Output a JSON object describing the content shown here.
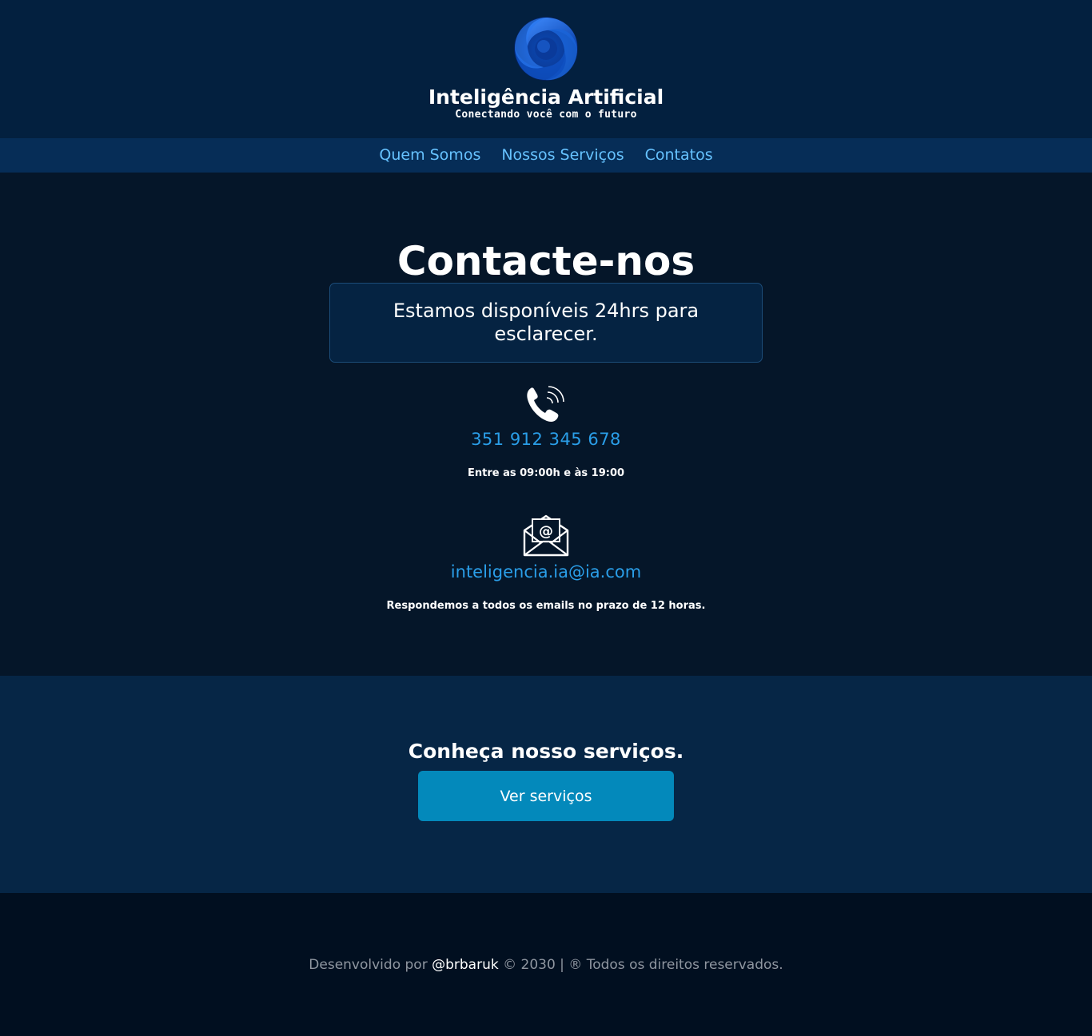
{
  "header": {
    "logo_icon": "swirl-logo-icon",
    "title": "Inteligência Artificial",
    "tagline": "Conectando você com o futuro"
  },
  "nav": {
    "items": [
      {
        "label": "Quem Somos"
      },
      {
        "label": "Nossos Serviços"
      },
      {
        "label": "Contatos"
      }
    ]
  },
  "contact": {
    "title": "Contacte-nos",
    "availability": "Estamos disponíveis 24hrs para esclarecer.",
    "phone_icon": "phone-icon",
    "phone": "351 912 345 678",
    "phone_hours": "Entre as 09:00h e às 19:00",
    "email_icon": "mail-icon",
    "email": "inteligencia.ia@ia.com",
    "email_note": "Respondemos a todos os emails no prazo de 12 horas."
  },
  "services": {
    "title": "Conheça nosso serviços.",
    "button_label": "Ver serviços"
  },
  "footer": {
    "prefix": "Desenvolvido por",
    "handle": "@brbaruk",
    "suffix": "© 2030 | ® Todos os direitos reservados."
  },
  "colors": {
    "header_bg": "#03203f",
    "nav_bg": "#062d57",
    "nav_link": "#66c2ff",
    "page_bg": "#051629",
    "accent_link": "#2a9ee8",
    "services_bg": "#062646",
    "button_bg": "#0389bb",
    "footer_bg": "#010f20"
  }
}
